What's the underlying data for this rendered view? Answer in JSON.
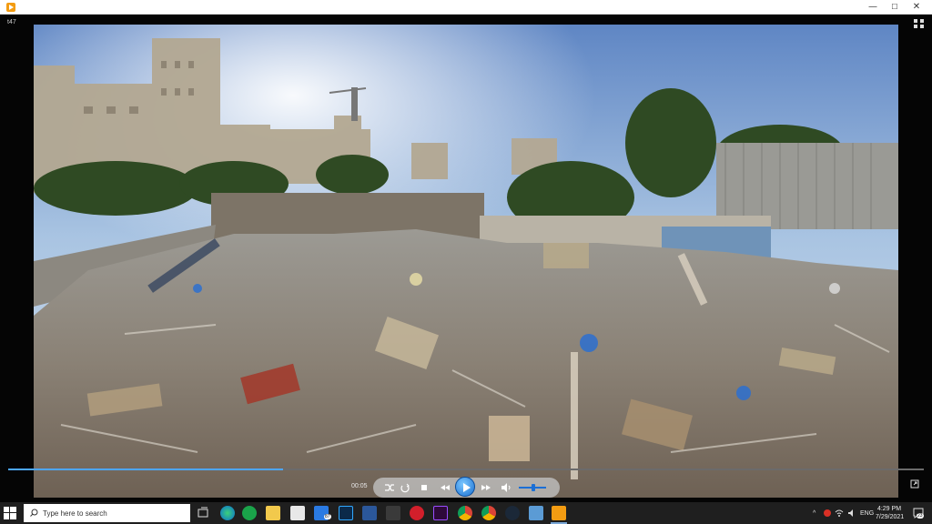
{
  "window": {
    "title": "t47",
    "controls": {
      "minimize": "—",
      "maximize": "☐",
      "close": "✕"
    }
  },
  "player": {
    "time_elapsed": "00:05",
    "progress_fraction": 0.3,
    "volume_fraction": 0.5
  },
  "taskbar": {
    "search_placeholder": "Type here to search",
    "mail_badge": "87",
    "tray_language": "ENG",
    "clock_time": "4:29 PM",
    "clock_date": "7/29/2021",
    "notification_count": "23"
  },
  "colors": {
    "accent": "#1b6fd6",
    "progress": "#4da6ff"
  }
}
